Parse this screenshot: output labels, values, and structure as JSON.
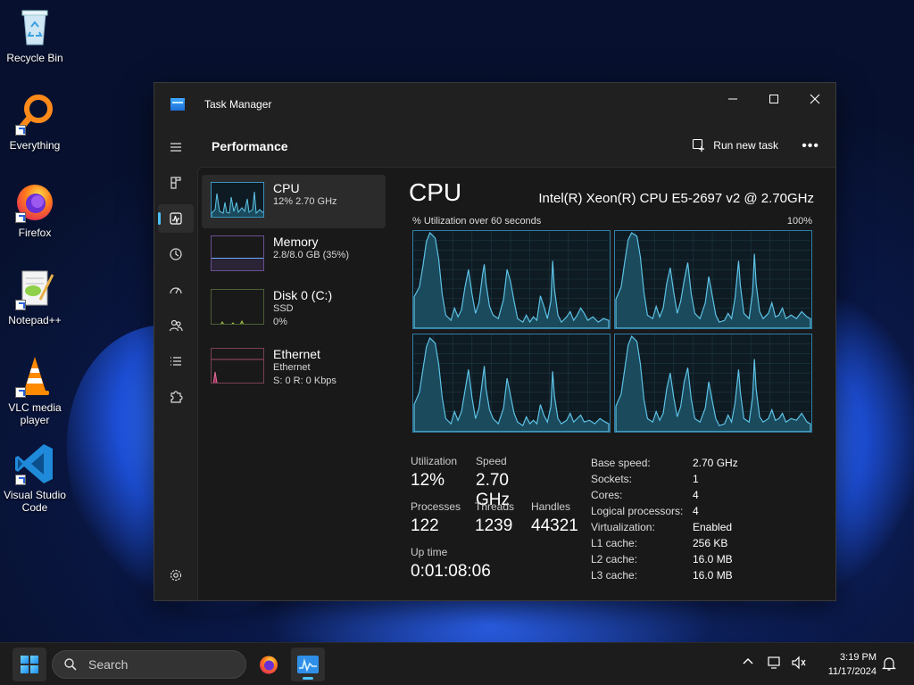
{
  "desktop": {
    "icons": [
      {
        "label": "Recycle Bin"
      },
      {
        "label": "Everything"
      },
      {
        "label": "Firefox"
      },
      {
        "label": "Notepad++"
      },
      {
        "label": "VLC media player"
      },
      {
        "label": "Visual Studio Code"
      }
    ]
  },
  "window": {
    "title": "Task Manager",
    "page_title": "Performance",
    "run_new_task": "Run new task",
    "more": "•••"
  },
  "nav": {
    "items": [
      "hamburger-menu",
      "processes",
      "performance",
      "app-history",
      "startup-apps",
      "users",
      "details",
      "services"
    ],
    "active": "performance",
    "settings": "settings"
  },
  "devices": [
    {
      "name": "CPU",
      "sub1": "12%  2.70 GHz",
      "sub2": ""
    },
    {
      "name": "Memory",
      "sub1": "2.8/8.0 GB (35%)",
      "sub2": ""
    },
    {
      "name": "Disk 0 (C:)",
      "sub1": "SSD",
      "sub2": "0%"
    },
    {
      "name": "Ethernet",
      "sub1": "Ethernet",
      "sub2": "S: 0  R: 0 Kbps"
    }
  ],
  "cpu": {
    "title": "CPU",
    "model": "Intel(R) Xeon(R) CPU E5-2697 v2 @ 2.70GHz",
    "util_label": "% Utilization over 60 seconds",
    "util_max": "100%",
    "stats": {
      "utilization_label": "Utilization",
      "utilization": "12%",
      "speed_label": "Speed",
      "speed": "2.70 GHz",
      "processes_label": "Processes",
      "processes": "122",
      "threads_label": "Threads",
      "threads": "1239",
      "handles_label": "Handles",
      "handles": "44321",
      "uptime_label": "Up time",
      "uptime": "0:01:08:06"
    },
    "specs": [
      {
        "k": "Base speed:",
        "v": "2.70 GHz"
      },
      {
        "k": "Sockets:",
        "v": "1"
      },
      {
        "k": "Cores:",
        "v": "4"
      },
      {
        "k": "Logical processors:",
        "v": "4"
      },
      {
        "k": "Virtualization:",
        "v": "Enabled"
      },
      {
        "k": "L1 cache:",
        "v": "256 KB"
      },
      {
        "k": "L2 cache:",
        "v": "16.0 MB"
      },
      {
        "k": "L3 cache:",
        "v": "16.0 MB"
      }
    ]
  },
  "taskbar": {
    "search_placeholder": "Search",
    "time": "3:19 PM",
    "date": "11/17/2024"
  },
  "colors": {
    "accent": "#4cc2ff",
    "graph_line": "#5fc4e8",
    "graph_fill": "#1a4a5c",
    "memory": "#9b6bd6",
    "disk": "#7fb93a",
    "ethernet": "#d45c8a"
  }
}
